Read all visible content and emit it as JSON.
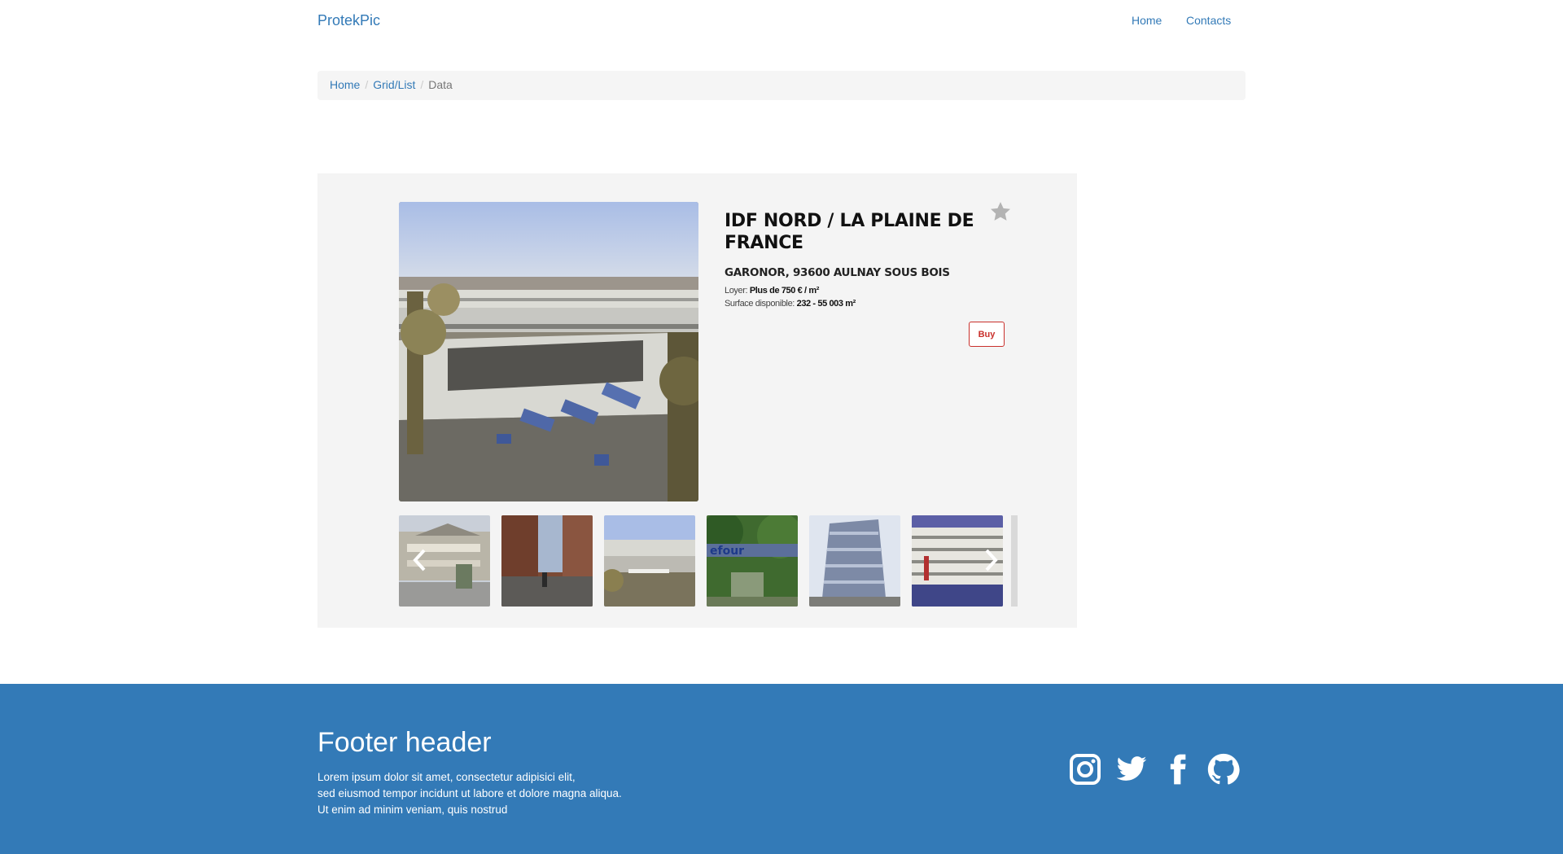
{
  "navbar": {
    "brand": "ProtekPic",
    "links": [
      "Home",
      "Contacts"
    ]
  },
  "breadcrumb": [
    "Home",
    "Grid/List",
    "Data"
  ],
  "listing": {
    "title": "IDF NORD / LA PLAINE DE FRANCE",
    "address": "GARONOR, 93600 AULNAY SOUS BOIS",
    "rent_label": "Loyer:",
    "rent_value": "Plus de 750 € / m²",
    "surface_label": "Surface disponible:",
    "surface_value": "232 - 55 003 m²",
    "buy_label": "Buy",
    "favorite_icon": "star-icon",
    "thumbnail_count": 6,
    "arrow_icons": [
      "chevron-left-icon",
      "chevron-right-icon"
    ]
  },
  "footer": {
    "title": "Footer header",
    "lines": [
      "Lorem ipsum dolor sit amet, consectetur adipisici elit,",
      "sed eiusmod tempor incidunt ut labore et dolore magna aliqua.",
      "Ut enim ad minim veniam, quis nostrud"
    ],
    "social_icons": [
      "instagram-icon",
      "twitter-icon",
      "facebook-icon",
      "github-icon"
    ]
  },
  "colors": {
    "primary": "#337ab7",
    "buy": "#c9302c",
    "card_bg": "#f4f4f4",
    "breadcrumb_bg": "#f5f5f5"
  }
}
